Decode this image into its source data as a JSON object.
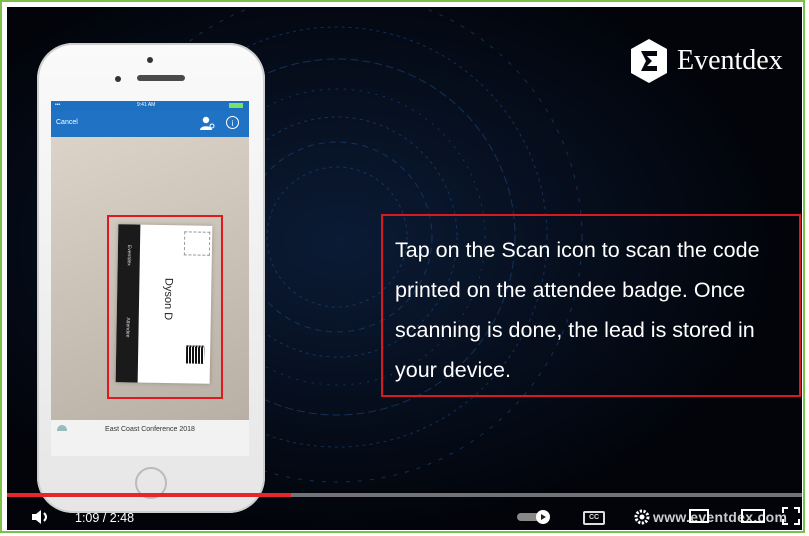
{
  "phone": {
    "status_time": "9:41 AM",
    "cancel_label": "Cancel",
    "badge_org": "Eventdex",
    "badge_name": "Dyson D",
    "badge_role": "Attendee",
    "footer_text": "East Coast Conference 2018"
  },
  "logo": {
    "text": "Eventdex"
  },
  "caption": {
    "text": "Tap on the Scan icon to scan the code printed on the attendee badge. Once scanning is done, the lead is stored in your device."
  },
  "player": {
    "time": "1:09 / 2:48",
    "progress": 0.357,
    "cc_label": "CC",
    "watermark": "www.eventdex.com"
  },
  "colors": {
    "highlight": "#d81920",
    "app_bar": "#1f72c4",
    "progress": "#e5262a",
    "frame_border": "#7cc04a"
  },
  "icons": [
    "user-scan-icon",
    "info-icon",
    "volume-icon",
    "autoplay-toggle-icon",
    "cc-icon",
    "settings-icon",
    "miniplayer-icon",
    "theater-icon",
    "fullscreen-icon"
  ]
}
